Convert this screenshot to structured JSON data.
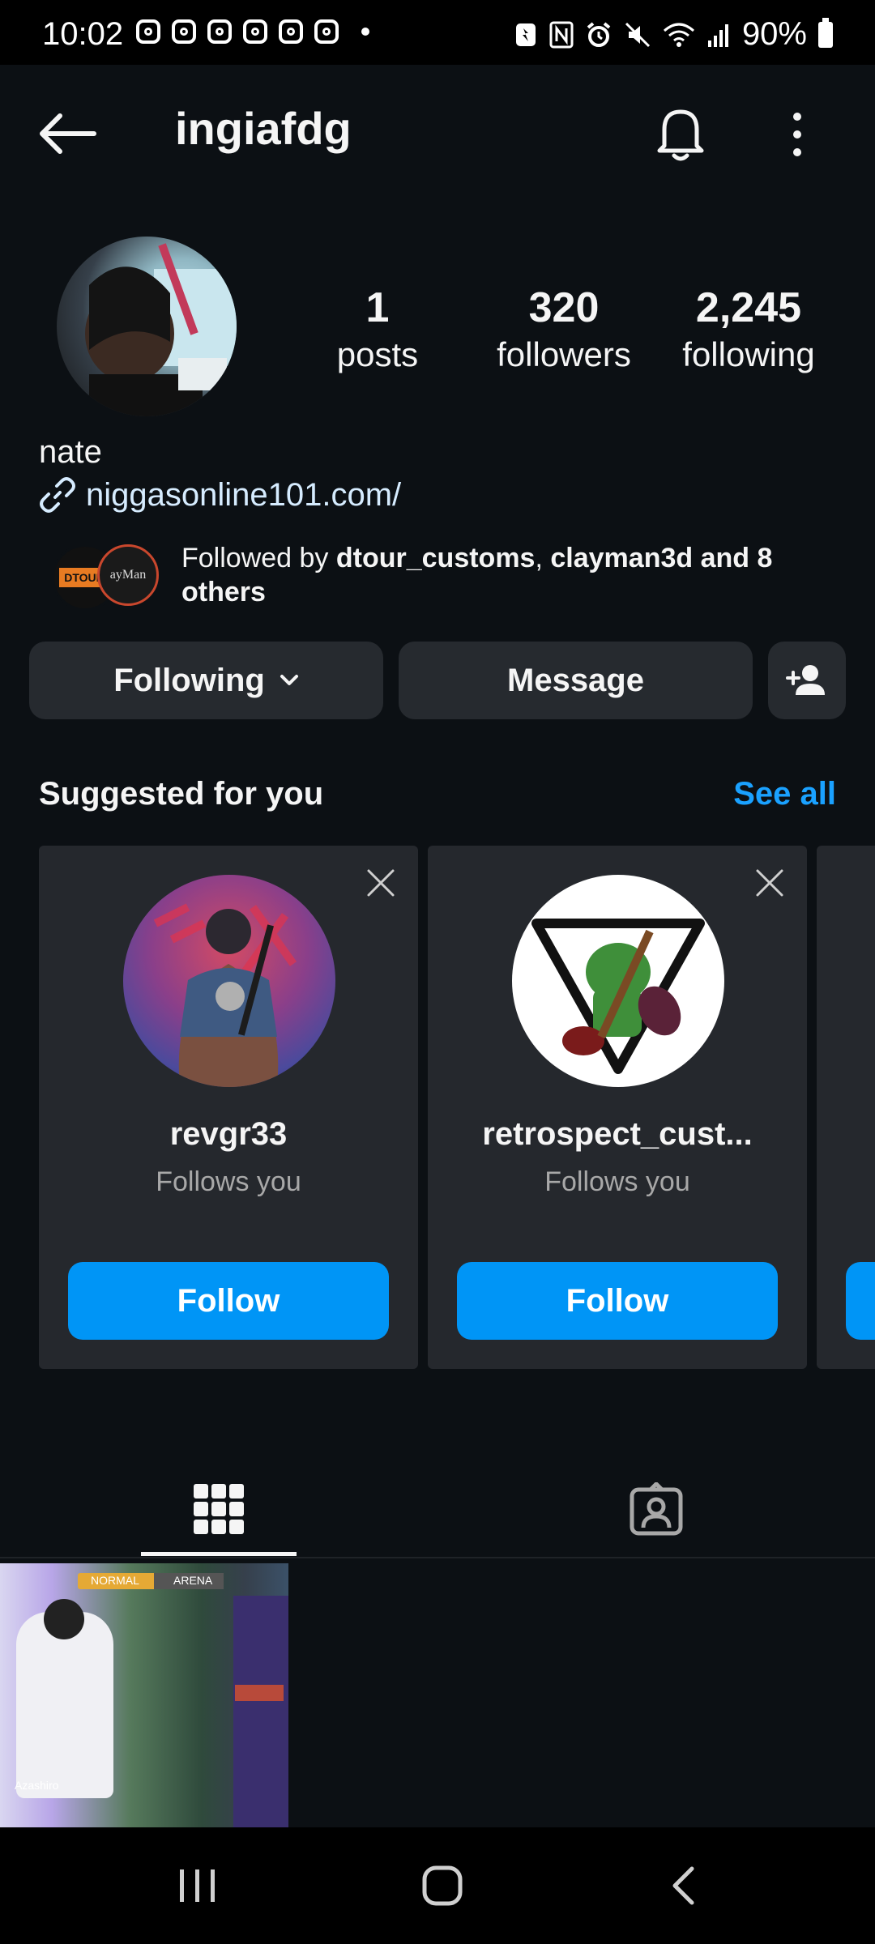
{
  "status_bar": {
    "time": "10:02",
    "battery": "90%",
    "notification_icons": [
      "instagram-icon",
      "instagram-icon",
      "instagram-icon",
      "instagram-icon",
      "instagram-icon",
      "instagram-icon"
    ]
  },
  "header": {
    "username": "ingiafdg"
  },
  "profile": {
    "stats": [
      {
        "value": "1",
        "label": "posts"
      },
      {
        "value": "320",
        "label": "followers"
      },
      {
        "value": "2,245",
        "label": "following"
      }
    ],
    "name": "nate",
    "link": "niggasonline101.com/",
    "followed_by": {
      "prefix": "Followed by ",
      "user1": "dtour_customs",
      "separator": ", ",
      "user2": "clayman3d",
      "suffix": " and 8 others"
    }
  },
  "actions": {
    "following_label": "Following",
    "message_label": "Message"
  },
  "suggested": {
    "title": "Suggested for you",
    "see_all": "See all",
    "cards": [
      {
        "username": "revgr33",
        "subtitle": "Follows you",
        "follow_label": "Follow"
      },
      {
        "username": "retrospect_cust...",
        "subtitle": "Follows you",
        "follow_label": "Follow"
      }
    ]
  },
  "post": {
    "badge_left": "NORMAL",
    "badge_right": "ARENA",
    "caption": "Azashiro"
  },
  "colors": {
    "background": "#0c1014",
    "button": "#262a2f",
    "accent": "#0095f6",
    "link": "#1aa1ff"
  }
}
